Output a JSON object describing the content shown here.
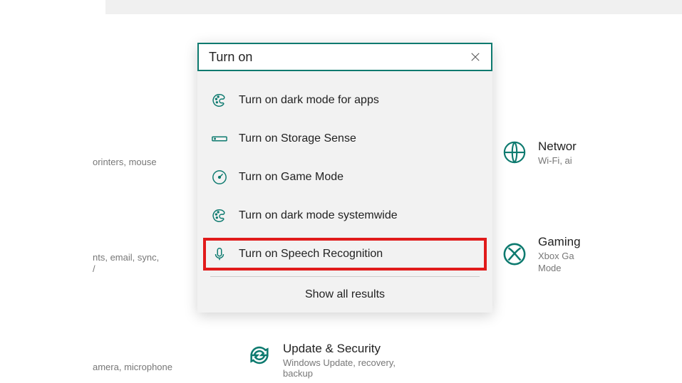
{
  "search": {
    "value": "Turn on",
    "clear_icon": "close-icon"
  },
  "results": [
    {
      "icon": "palette-icon",
      "label": "Turn on dark mode for apps"
    },
    {
      "icon": "storage-icon",
      "label": "Turn on Storage Sense"
    },
    {
      "icon": "gauge-icon",
      "label": "Turn on Game Mode"
    },
    {
      "icon": "palette-icon",
      "label": "Turn on dark mode systemwide"
    },
    {
      "icon": "mic-icon",
      "label": "Turn on Speech Recognition",
      "highlighted": true
    }
  ],
  "show_all_label": "Show all results",
  "background": {
    "frag_devices": "orinters, mouse",
    "frag_accounts_1": "nts, email, sync,",
    "frag_accounts_2": "/",
    "frag_privacy": "amera, microphone",
    "network": {
      "title": "Networ",
      "sub": "Wi-Fi, ai"
    },
    "gaming": {
      "title": "Gaming",
      "sub": "Xbox Ga",
      "sub2": "Mode"
    },
    "update": {
      "title": "Update & Security",
      "sub": "Windows Update, recovery, backup"
    }
  },
  "colors": {
    "accent": "#0d7a6f",
    "highlight_border": "#e11b1b"
  }
}
